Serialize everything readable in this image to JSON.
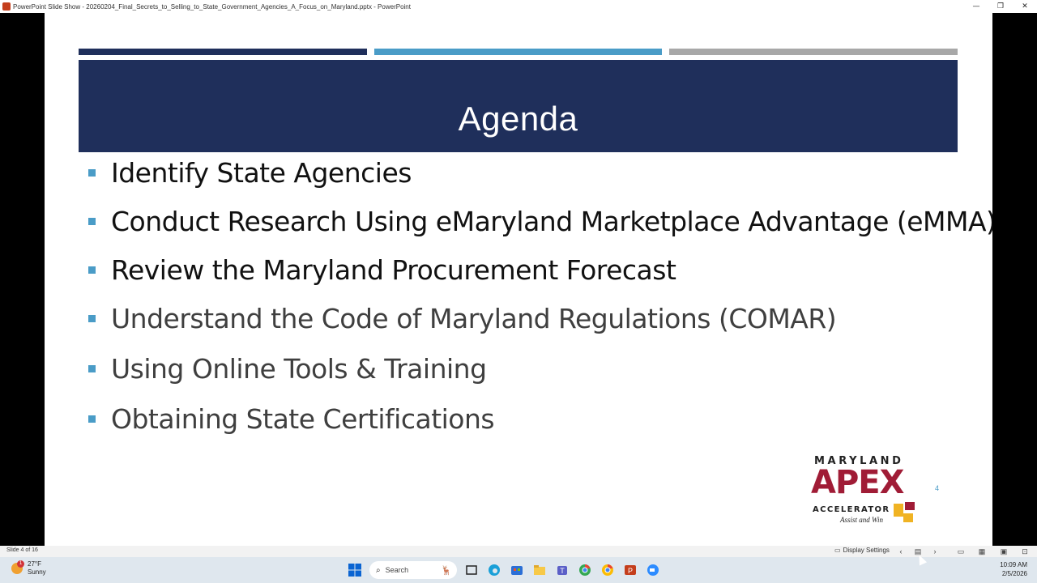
{
  "window": {
    "title": "PowerPoint Slide Show  -  20260204_Final_Secrets_to_Selling_to_State_Government_Agencies_A_Focus_on_Maryland.pptx - PowerPoint",
    "minimize": "—",
    "restore": "❐",
    "close": "✕"
  },
  "slide": {
    "title": "Agenda",
    "bullets": [
      {
        "text": "Identify State Agencies",
        "tone": "dark"
      },
      {
        "text": "Conduct Research Using eMaryland Marketplace Advantage (eMMA)",
        "tone": "dark"
      },
      {
        "text": "Review the Maryland Procurement Forecast",
        "tone": "dark"
      },
      {
        "text": "Understand the Code of Maryland Regulations (COMAR)",
        "tone": "grey"
      },
      {
        "text": "Using Online Tools & Training",
        "tone": "grey"
      },
      {
        "text": "Obtaining State Certifications",
        "tone": "grey"
      }
    ],
    "logo": {
      "line1": "MARYLAND",
      "line2": "APEX",
      "line3": "ACCELERATOR",
      "tagline": "Assist and Win"
    },
    "page_number": "4",
    "colors": {
      "navy": "#1f2f5b",
      "blue": "#4a9cc7",
      "grey": "#a8a8a8",
      "brand_red": "#a01c36",
      "brand_gold": "#f0b323"
    }
  },
  "statusbar": {
    "slide_count": "Slide 4 of 16",
    "display_settings": "Display Settings",
    "icons": [
      "monitor-icon",
      "previous-icon",
      "slide-sorter-icon",
      "next-icon",
      "normal-view-icon",
      "grid-view-icon",
      "reading-view-icon",
      "slideshow-icon"
    ]
  },
  "taskbar": {
    "weather_temp": "27°F",
    "weather_desc": "Sunny",
    "weather_alert": "1",
    "search_placeholder": "Search",
    "time": "10:09 AM",
    "date": "2/5/2026",
    "apps": [
      "windows-start-icon",
      "taskview-icon",
      "edge-icon",
      "store-icon",
      "file-explorer-icon",
      "teams-icon",
      "chrome-icon",
      "chrome-profile-icon",
      "powerpoint-icon",
      "zoom-icon"
    ]
  }
}
